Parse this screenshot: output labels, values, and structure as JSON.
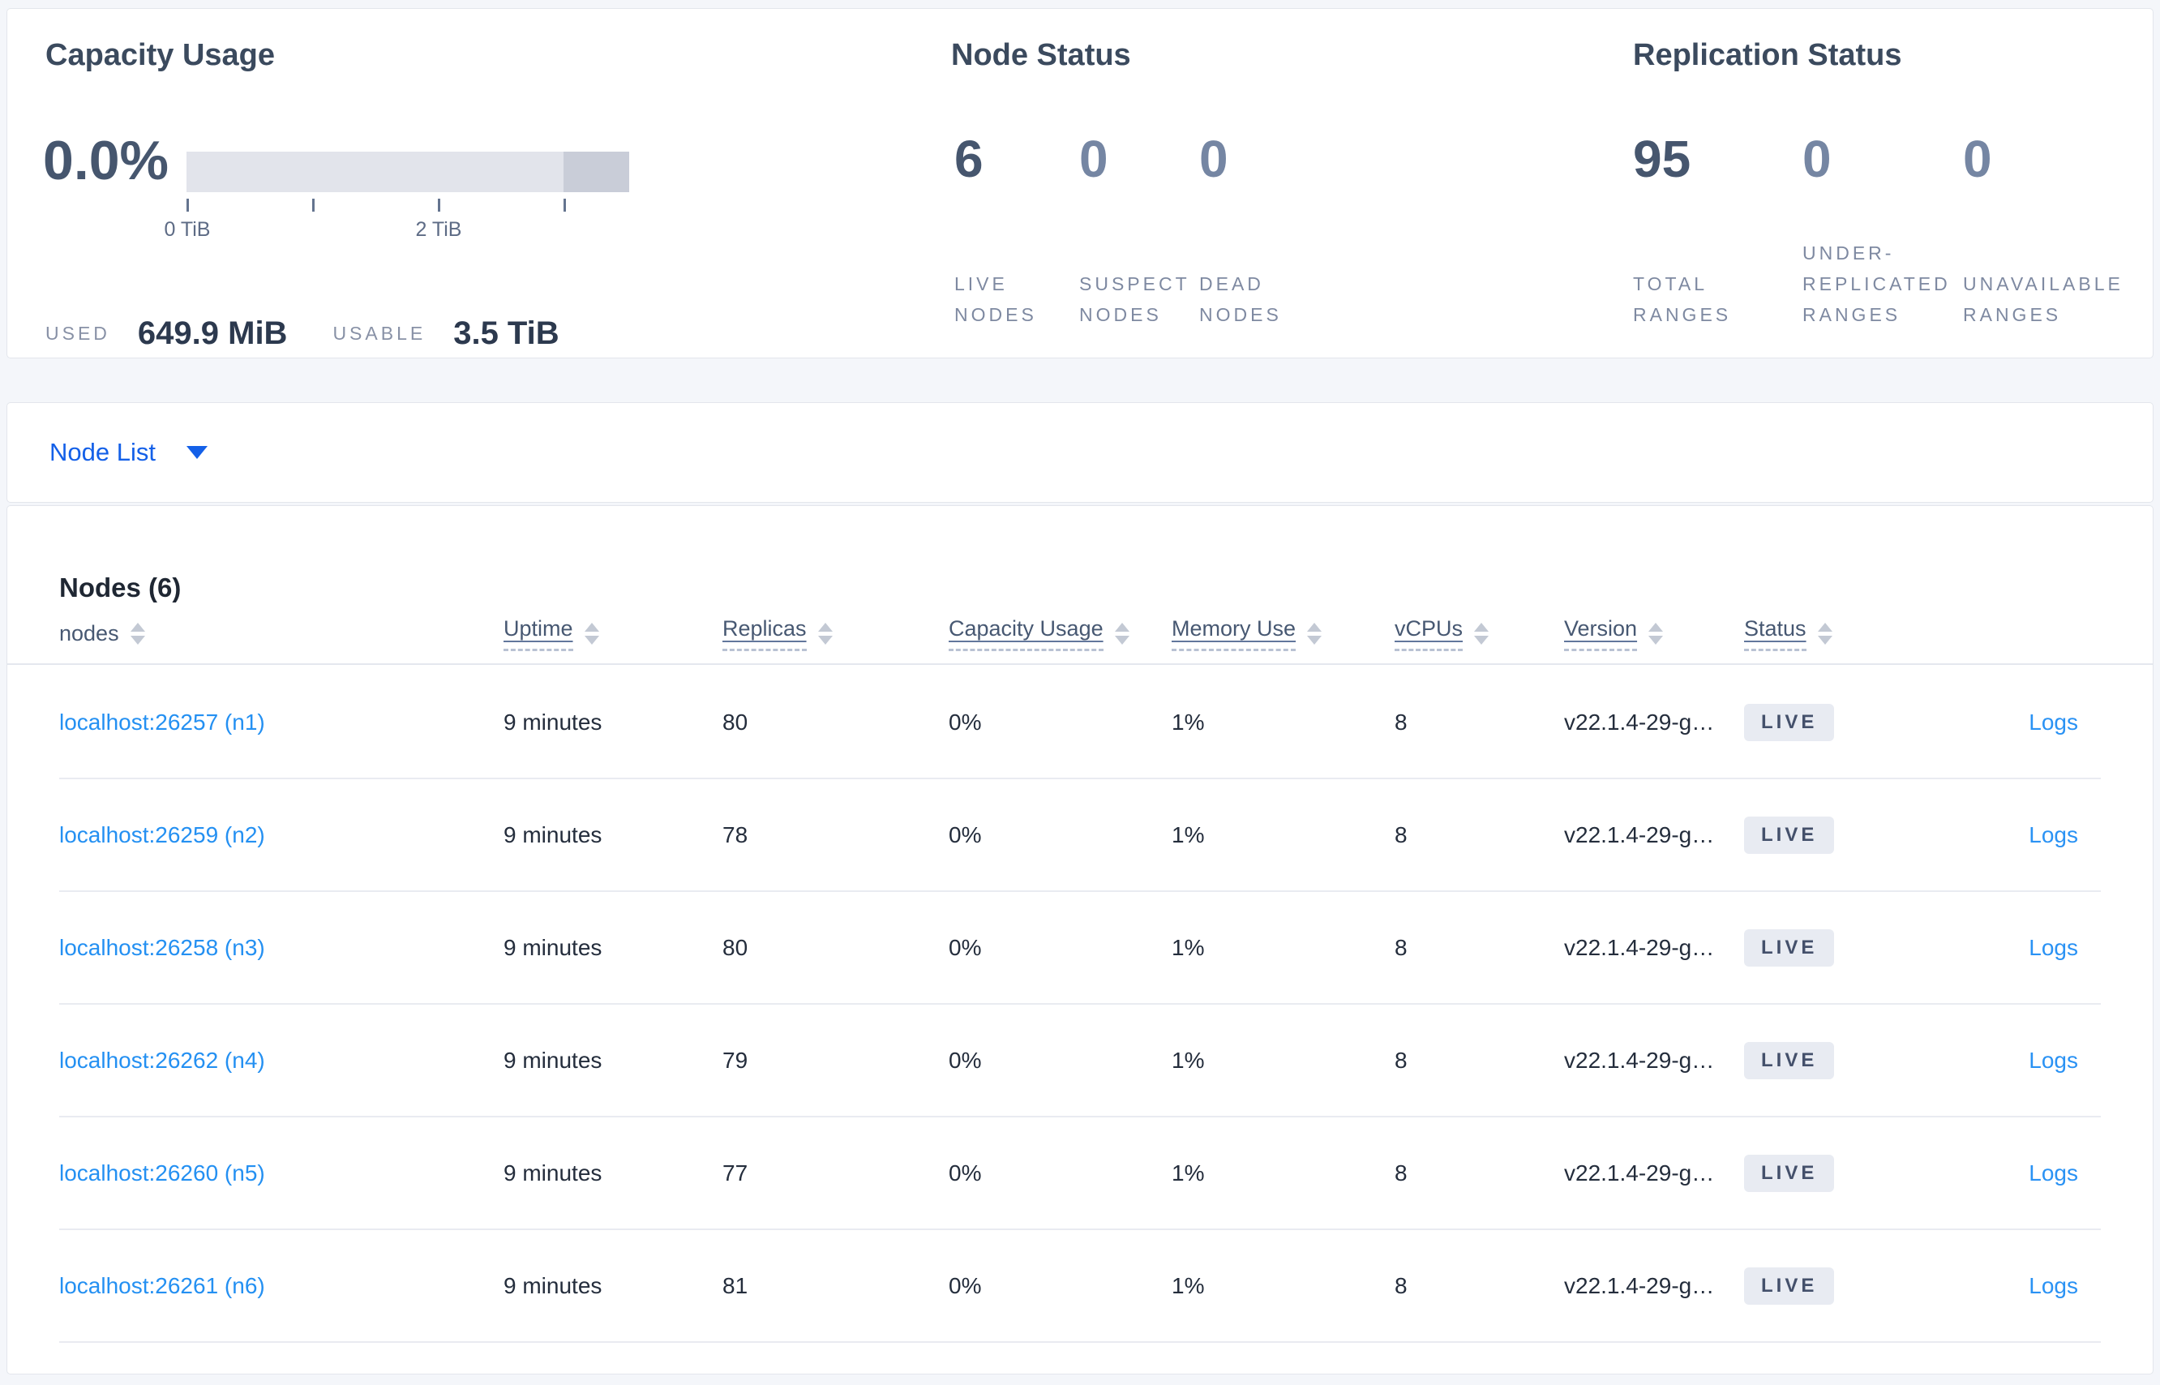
{
  "summary": {
    "capacity": {
      "title": "Capacity Usage",
      "percent": "0.0%",
      "tick_labels": [
        "0 TiB",
        "2 TiB"
      ],
      "used_label": "USED",
      "used_value": "649.9 MiB",
      "usable_label": "USABLE",
      "usable_value": "3.5 TiB"
    },
    "node_status": {
      "title": "Node Status",
      "stats": [
        {
          "value": "6",
          "label": "LIVE NODES"
        },
        {
          "value": "0",
          "label": "SUSPECT NODES"
        },
        {
          "value": "0",
          "label": "DEAD NODES"
        }
      ]
    },
    "replication": {
      "title": "Replication Status",
      "stats": [
        {
          "value": "95",
          "label": "TOTAL RANGES"
        },
        {
          "value": "0",
          "label": "UNDER-REPLICATED RANGES"
        },
        {
          "value": "0",
          "label": "UNAVAILABLE RANGES"
        }
      ]
    }
  },
  "view_selector": {
    "label": "Node List"
  },
  "table": {
    "title": "Nodes (6)",
    "columns": [
      {
        "label": "nodes"
      },
      {
        "label": "Uptime"
      },
      {
        "label": "Replicas"
      },
      {
        "label": "Capacity Usage"
      },
      {
        "label": "Memory Use"
      },
      {
        "label": "vCPUs"
      },
      {
        "label": "Version"
      },
      {
        "label": "Status"
      }
    ],
    "rows": [
      {
        "node": "localhost:26257 (n1)",
        "uptime": "9 minutes",
        "replicas": "80",
        "capacity": "0%",
        "memory": "1%",
        "vcpus": "8",
        "version": "v22.1.4-29-g…",
        "status": "LIVE",
        "logs": "Logs"
      },
      {
        "node": "localhost:26259 (n2)",
        "uptime": "9 minutes",
        "replicas": "78",
        "capacity": "0%",
        "memory": "1%",
        "vcpus": "8",
        "version": "v22.1.4-29-g…",
        "status": "LIVE",
        "logs": "Logs"
      },
      {
        "node": "localhost:26258 (n3)",
        "uptime": "9 minutes",
        "replicas": "80",
        "capacity": "0%",
        "memory": "1%",
        "vcpus": "8",
        "version": "v22.1.4-29-g…",
        "status": "LIVE",
        "logs": "Logs"
      },
      {
        "node": "localhost:26262 (n4)",
        "uptime": "9 minutes",
        "replicas": "79",
        "capacity": "0%",
        "memory": "1%",
        "vcpus": "8",
        "version": "v22.1.4-29-g…",
        "status": "LIVE",
        "logs": "Logs"
      },
      {
        "node": "localhost:26260 (n5)",
        "uptime": "9 minutes",
        "replicas": "77",
        "capacity": "0%",
        "memory": "1%",
        "vcpus": "8",
        "version": "v22.1.4-29-g…",
        "status": "LIVE",
        "logs": "Logs"
      },
      {
        "node": "localhost:26261 (n6)",
        "uptime": "9 minutes",
        "replicas": "81",
        "capacity": "0%",
        "memory": "1%",
        "vcpus": "8",
        "version": "v22.1.4-29-g…",
        "status": "LIVE",
        "logs": "Logs"
      }
    ]
  },
  "colors": {
    "page_bg": "#f4f6fa",
    "card_border": "#e3e6ec",
    "accent_link_blue": "#2a92f4",
    "selector_blue": "#1460e8",
    "big_number": "#46566e",
    "muted_number": "#7586a3",
    "label_gray": "#7e89a1",
    "bar_track": "#e2e4eb",
    "bar_dark_segment": "#c9cdd8",
    "badge_bg": "#e8ebf2"
  }
}
